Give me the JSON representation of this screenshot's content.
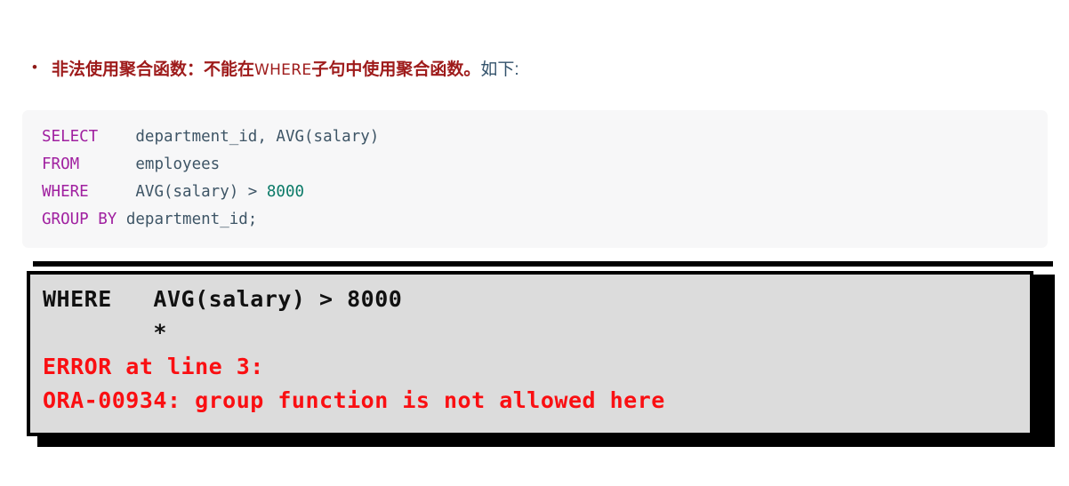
{
  "bullet": {
    "marker": "•",
    "segment_heading": "非法使用聚合函数：",
    "segment_body_before": "不能在",
    "segment_keyword": "WHERE",
    "segment_body_after": "子句中使用聚合函数。",
    "segment_tail": "如下:",
    "color_red": "#9e1b1b",
    "color_slate": "#33526b"
  },
  "code_block": {
    "language": "sql",
    "background": "#f7f7f8",
    "keyword_color": "#a020a0",
    "identifier_color": "#3e5566",
    "number_color": "#0b7a68",
    "lines": [
      {
        "keyword": "SELECT",
        "gap": "    ",
        "rest": "department_id, AVG(salary)"
      },
      {
        "keyword": "FROM",
        "gap": "      ",
        "rest": "employees"
      },
      {
        "keyword": "WHERE",
        "gap": "     ",
        "rest": "AVG(salary) > 8000"
      },
      {
        "keyword": "GROUP BY",
        "gap": " ",
        "rest": "department_id;"
      }
    ],
    "full_text": "SELECT    department_id, AVG(salary)\nFROM      employees\nWHERE     AVG(salary) > 8000\nGROUP BY department_id;"
  },
  "terminal": {
    "background": "#dcdcdc",
    "border_color": "#000000",
    "text_color": "#111111",
    "error_color": "#fa0f12",
    "line_echo": "WHERE   AVG(salary) > 8000",
    "line_pointer": "        *",
    "line_error_header": "ERROR at line 3:",
    "line_error_message": "ORA-00934: group function is not allowed here"
  }
}
